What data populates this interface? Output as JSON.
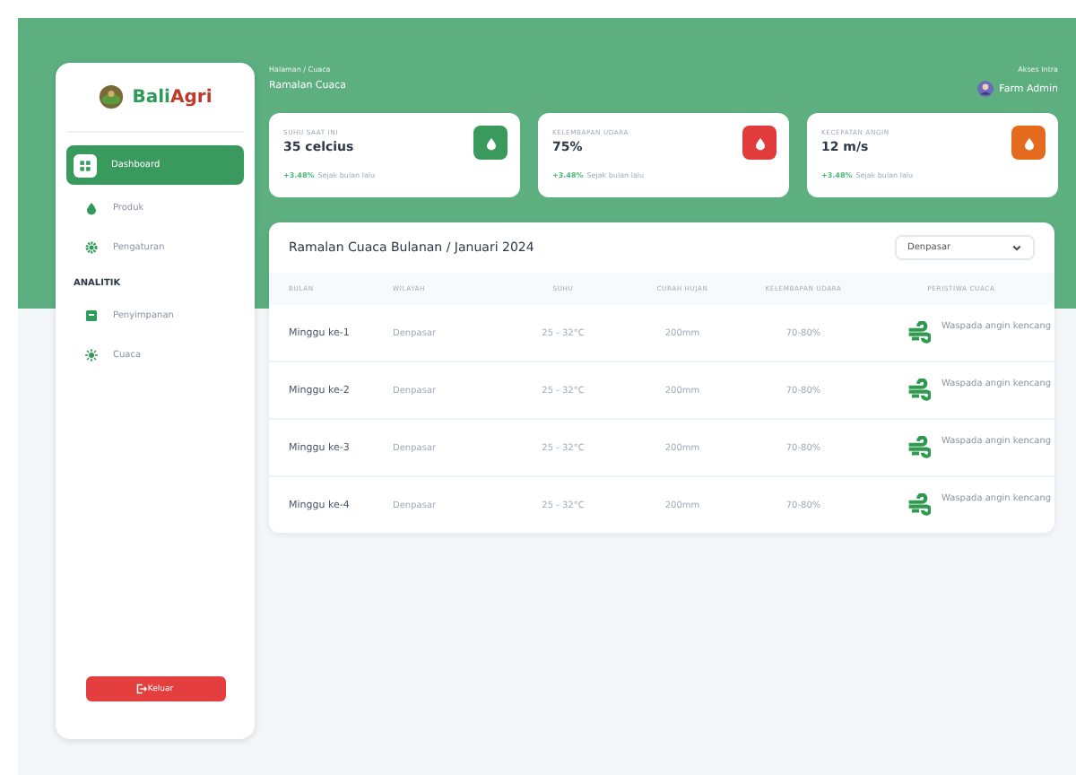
{
  "sidebar": {
    "brand": [
      "Bali",
      "Agri"
    ],
    "items": [
      {
        "kind": "link",
        "label": "Dashboard",
        "selected": true
      },
      {
        "kind": "link",
        "label": "Produk",
        "selected": false
      },
      {
        "kind": "link",
        "label": "Pengaturan",
        "selected": false
      },
      {
        "kind": "section",
        "label": "ANALITIK"
      },
      {
        "kind": "link",
        "label": "Penyimpanan",
        "selected": false
      },
      {
        "kind": "link",
        "label": "Cuaca",
        "selected": false
      }
    ],
    "logout": "Keluar"
  },
  "header": {
    "breadcrumb": "Halaman / Cuaca",
    "title": "Ramalan Cuaca",
    "user_caption": "Akses Intra",
    "user": "Farm Admin"
  },
  "stats": [
    {
      "label": "SUHU SAAT INI",
      "value": "35 celcius",
      "color": "#3a9a5e",
      "change": "+3.48%",
      "note": "Sejak bulan lalu"
    },
    {
      "label": "KELEMBAPAN UDARA",
      "value": "75%",
      "color": "#e23b3b",
      "change": "+3.48%",
      "note": "Sejak bulan lalu"
    },
    {
      "label": "KECEPATAN ANGIN",
      "value": "12 m/s",
      "color": "#e46b1e",
      "change": "+3.48%",
      "note": "Sejak bulan lalu"
    }
  ],
  "table": {
    "title": "Ramalan Cuaca Bulanan / Januari 2024",
    "filter": "Denpasar",
    "columns": [
      "BULAN",
      "WILAYAH",
      "SUHU",
      "CURAH HUJAN",
      "KELEMBAPAN UDARA",
      "PERISTIWA CUACA"
    ],
    "rows": [
      [
        "Minggu ke-1",
        "Denpasar",
        "25 - 32°C",
        "200mm",
        "70-80%",
        "Waspada angin kencang"
      ],
      [
        "Minggu ke-2",
        "Denpasar",
        "25 - 32°C",
        "200mm",
        "70-80%",
        "Waspada angin kencang"
      ],
      [
        "Minggu ke-3",
        "Denpasar",
        "25 - 32°C",
        "200mm",
        "70-80%",
        "Waspada angin kencang"
      ],
      [
        "Minggu ke-4",
        "Denpasar",
        "25 - 32°C",
        "200mm",
        "70-80%",
        "Waspada angin kencang"
      ]
    ]
  }
}
